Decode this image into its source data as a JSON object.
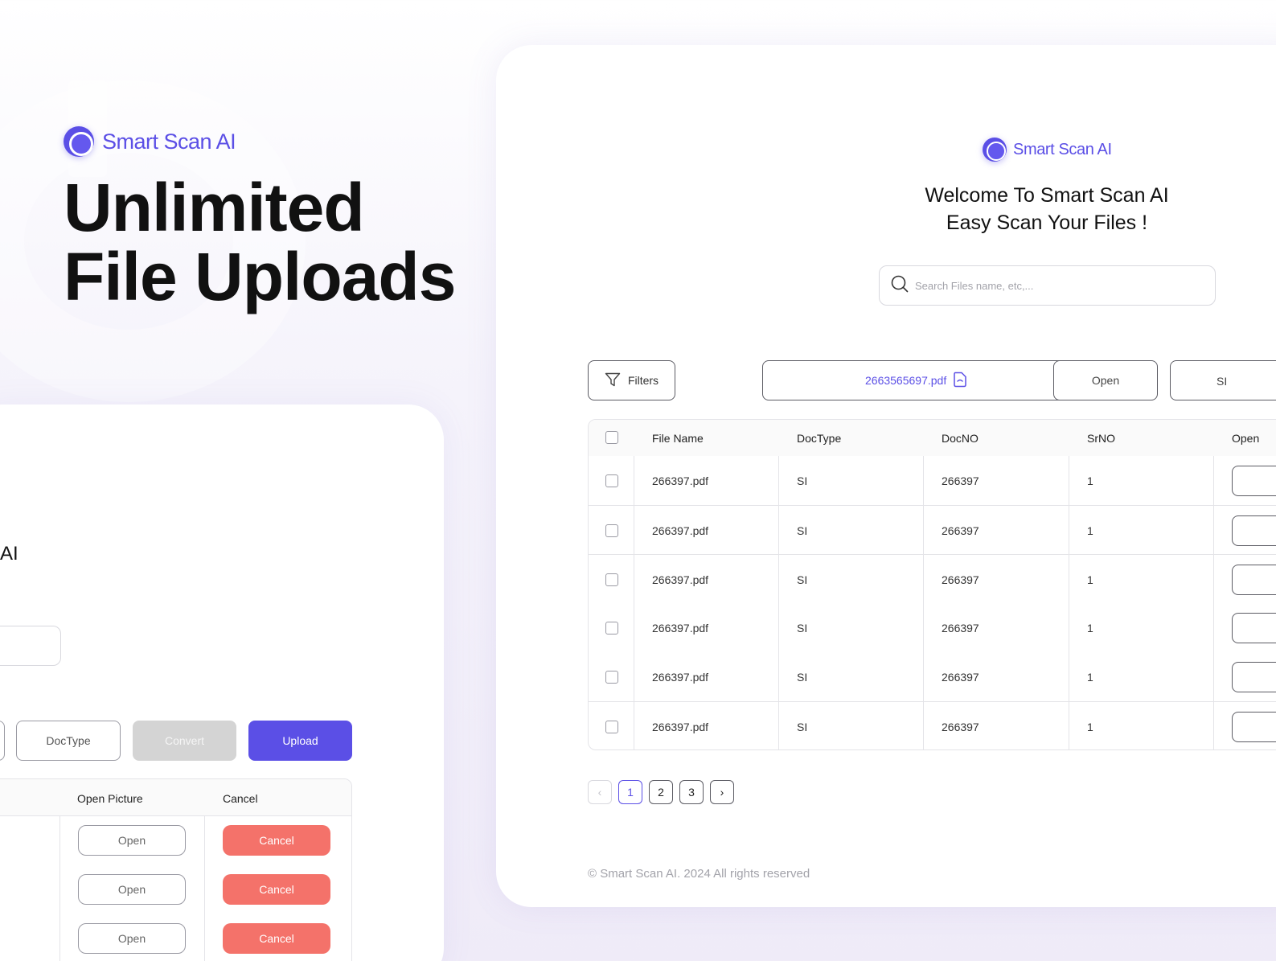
{
  "hero": {
    "logo_text": "Smart Scan AI",
    "title_line1": "Unlimited",
    "title_line2": "File Uploads"
  },
  "left_card": {
    "partial_heading": "AI",
    "buttons": {
      "doctype": "DocType",
      "convert": "Convert",
      "upload": "Upload"
    },
    "table": {
      "headers": [
        "Open Picture",
        "Cancel"
      ],
      "rows": [
        {
          "open": "Open",
          "cancel": "Cancel"
        },
        {
          "open": "Open",
          "cancel": "Cancel"
        },
        {
          "open": "Open",
          "cancel": "Cancel"
        }
      ]
    }
  },
  "right_card": {
    "logo_text": "Smart Scan AI",
    "welcome_line1": "Welcome To Smart Scan AI",
    "welcome_line2": "Easy Scan Your Files !",
    "search_placeholder": "Search Files name, etc,...",
    "filters_label": "Filters",
    "file_chip": "2663565697.pdf",
    "open_chip": "Open",
    "si_chip": "SI",
    "table": {
      "headers": [
        "File Name",
        "DocType",
        "DocNO",
        "SrNO",
        "Open"
      ],
      "rows": [
        {
          "file": "266397.pdf",
          "doctype": "SI",
          "docno": "266397",
          "srno": "1"
        },
        {
          "file": "266397.pdf",
          "doctype": "SI",
          "docno": "266397",
          "srno": "1"
        },
        {
          "file": "266397.pdf",
          "doctype": "SI",
          "docno": "266397",
          "srno": "1"
        },
        {
          "file": "266397.pdf",
          "doctype": "SI",
          "docno": "266397",
          "srno": "1"
        },
        {
          "file": "266397.pdf",
          "doctype": "SI",
          "docno": "266397",
          "srno": "1"
        },
        {
          "file": "266397.pdf",
          "doctype": "SI",
          "docno": "266397",
          "srno": "1"
        }
      ]
    },
    "pagination": {
      "prev": "‹",
      "pages": [
        "1",
        "2",
        "3"
      ],
      "next": "›",
      "current": "1"
    },
    "footer": "© Smart Scan AI. 2024 All rights reserved"
  },
  "colors": {
    "brand": "#5b4fe6",
    "cancel": "#f4726a",
    "disabled": "#d4d4d4"
  }
}
